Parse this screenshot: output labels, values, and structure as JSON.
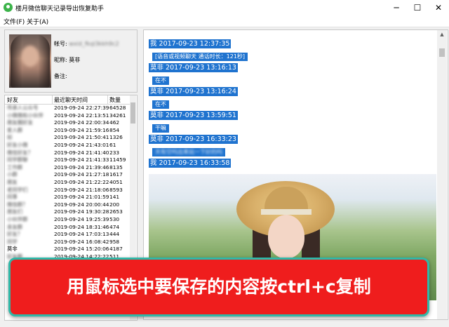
{
  "window": {
    "title": "楼月微信聊天记录导出恢复助手",
    "minimize_glyph": "─",
    "maximize_glyph": "☐",
    "close_glyph": "✕"
  },
  "menu": [
    "文件(F)",
    "关于(A)"
  ],
  "profile": {
    "account_label": "帐号:",
    "account_value": "wxid_fkql3kkh9c2",
    "nickname_label": "昵称:",
    "nickname_value": "莫非",
    "remark_label": "备注:",
    "remark_value": ""
  },
  "friends": {
    "headers": [
      "好友",
      "最近聊天时间",
      "数量"
    ],
    "rows": [
      {
        "name": "传承人公众号",
        "time": "2019-09-24 22:27:39",
        "count": "64528",
        "blurred": true
      },
      {
        "name": "小微微和小伙伴",
        "time": "2019-09-24 22:13:51",
        "count": "34261",
        "blurred": true
      },
      {
        "name": "朋友圈好友",
        "time": "2019-09-24 22:00:34",
        "count": "462",
        "blurred": true
      },
      {
        "name": "家人群",
        "time": "2019-09-24 21:59:16",
        "count": "854",
        "blurred": true
      },
      {
        "name": "如",
        "time": "2019-09-24 21:50:41",
        "count": "1326",
        "blurred": true
      },
      {
        "name": "好友小微",
        "time": "2019-09-24 21:43:01",
        "count": "61",
        "blurred": true
      },
      {
        "name": "微信好友？",
        "time": "2019-09-24 21:41:40",
        "count": "233",
        "blurred": true
      },
      {
        "name": "同学群聊",
        "time": "2019-09-24 21:41:33",
        "count": "11459",
        "blurred": true
      },
      {
        "name": "工作群",
        "time": "2019-09-24 21:39:46",
        "count": "8135",
        "blurred": true
      },
      {
        "name": "小群",
        "time": "2019-09-24 21:27:18",
        "count": "1617",
        "blurred": true
      },
      {
        "name": "朋友",
        "time": "2019-09-24 21:22:22",
        "count": "4051",
        "blurred": true
      },
      {
        "name": "老同学们",
        "time": "2019-09-24 21:18:06",
        "count": "8593",
        "blurred": true
      },
      {
        "name": "同事",
        "time": "2019-09-24 21:01:59",
        "count": "141",
        "blurred": true
      },
      {
        "name": "微信群？",
        "time": "2019-09-24 20:00:44",
        "count": "200",
        "blurred": true
      },
      {
        "name": "朋友们",
        "time": "2019-09-24 19:30:28",
        "count": "2653",
        "blurred": true
      },
      {
        "name": "小伙伴群",
        "time": "2019-09-24 19:25:39",
        "count": "530",
        "blurred": true
      },
      {
        "name": "亲友群",
        "time": "2019-09-24 18:31:46",
        "count": "474",
        "blurred": true
      },
      {
        "name": "好友？",
        "time": "2019-09-24 17:03:13",
        "count": "444",
        "blurred": true
      },
      {
        "name": "同学",
        "time": "2019-09-24 16:08:42",
        "count": "958",
        "blurred": true
      },
      {
        "name": "莫非",
        "time": "2019-09-24 15:20:06",
        "count": "4187",
        "blurred": false
      },
      {
        "name": "好友群",
        "time": "2019-09-24 14:22:22",
        "count": "511",
        "blurred": true
      }
    ]
  },
  "chat": {
    "messages": [
      {
        "sender": "我",
        "time": "2017-09-23 12:37:35",
        "body": "[语音或视频聊天 通话时长：121秒]",
        "blurred": false
      },
      {
        "sender": "莫非",
        "time": "2017-09-23 13:16:13",
        "body": "在不",
        "blurred": false
      },
      {
        "sender": "莫非",
        "time": "2017-09-23 13:16:24",
        "body": "在不",
        "blurred": false
      },
      {
        "sender": "莫非",
        "time": "2017-09-23 13:59:51",
        "body": "干嘛",
        "blurred": false
      },
      {
        "sender": "莫非",
        "time": "2017-09-23 16:33:23",
        "body": "天有空吗出来玩一下好的吗",
        "blurred": true
      },
      {
        "sender": "我",
        "time": "2017-09-23 16:33:58",
        "body": "",
        "blurred": false
      }
    ]
  },
  "banner": {
    "text": "用鼠标选中要保存的内容按ctrl+c复制",
    "background": "#ef1d1d",
    "border": "#2fb8a8"
  },
  "colors": {
    "selection": "#1f73cf",
    "app_icon": "#3cb34a"
  }
}
